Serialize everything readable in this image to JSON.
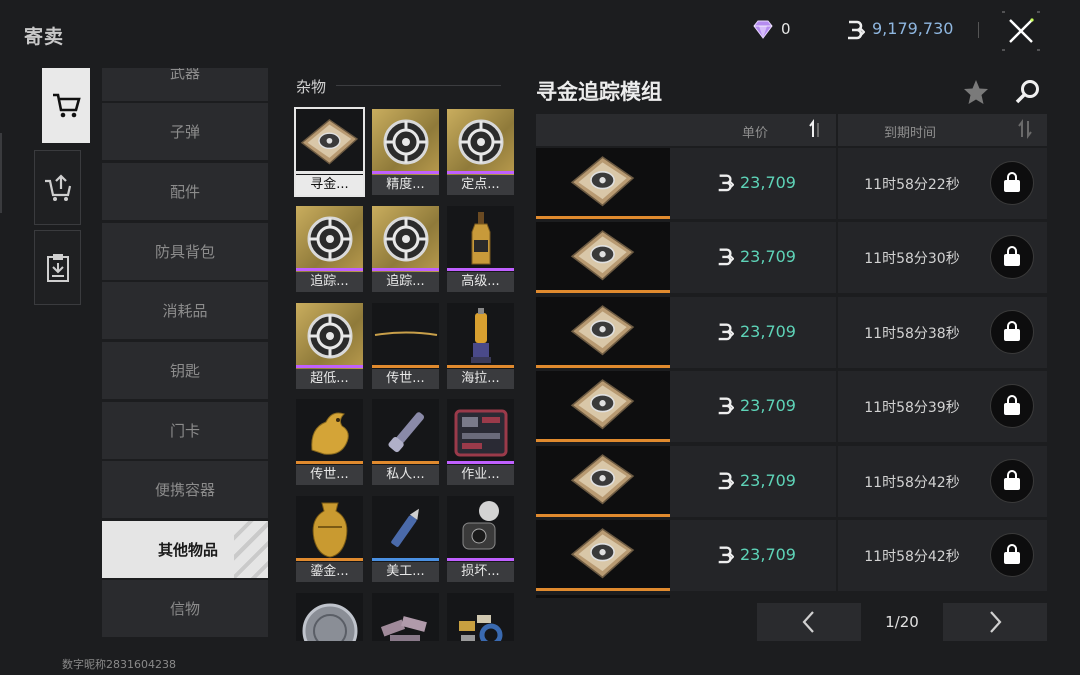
{
  "header": {
    "title": "寄卖",
    "gems": "0",
    "money": "9,179,730"
  },
  "categories": [
    {
      "label": "武器",
      "active": false
    },
    {
      "label": "子弹",
      "active": false
    },
    {
      "label": "配件",
      "active": false
    },
    {
      "label": "防具背包",
      "active": false
    },
    {
      "label": "消耗品",
      "active": false
    },
    {
      "label": "钥匙",
      "active": false
    },
    {
      "label": "门卡",
      "active": false
    },
    {
      "label": "便携容器",
      "active": false
    },
    {
      "label": "其他物品",
      "active": true
    },
    {
      "label": "信物",
      "active": false
    }
  ],
  "grid": {
    "title": "杂物",
    "items": [
      {
        "label": "寻金...",
        "icon": "gold-tracker-module-icon",
        "rarity": "#e6e6e6",
        "selected": true
      },
      {
        "label": "精度...",
        "icon": "precision-module-icon",
        "rarity": "#c060ff"
      },
      {
        "label": "定点...",
        "icon": "fixed-point-module-icon",
        "rarity": "#c060ff"
      },
      {
        "label": "追踪...",
        "icon": "tracking-module-a-icon",
        "rarity": "#c060ff"
      },
      {
        "label": "追踪...",
        "icon": "tracking-module-b-icon",
        "rarity": "#c060ff"
      },
      {
        "label": "高级...",
        "icon": "liquor-bottle-icon",
        "rarity": "#c060ff"
      },
      {
        "label": "超低...",
        "icon": "low-temp-module-icon",
        "rarity": "#c060ff"
      },
      {
        "label": "传世...",
        "icon": "heirloom-rod-icon",
        "rarity": "#e08a2e"
      },
      {
        "label": "海拉...",
        "icon": "hela-lamp-icon",
        "rarity": "#e08a2e"
      },
      {
        "label": "传世...",
        "icon": "golden-dragon-icon",
        "rarity": "#e08a2e"
      },
      {
        "label": "私人...",
        "icon": "flashlight-icon",
        "rarity": "#e08a2e"
      },
      {
        "label": "作业...",
        "icon": "toolkit-icon",
        "rarity": "#c060ff"
      },
      {
        "label": "鎏金...",
        "icon": "gilded-vase-icon",
        "rarity": "#e08a2e"
      },
      {
        "label": "美工...",
        "icon": "utility-knife-icon",
        "rarity": "#4a90e2"
      },
      {
        "label": "损坏...",
        "icon": "broken-device-icon",
        "rarity": "#c060ff"
      },
      {
        "label": "",
        "icon": "silver-coin-icon",
        "rarity": "#000000"
      },
      {
        "label": "",
        "icon": "metal-bars-icon",
        "rarity": "#000000"
      },
      {
        "label": "",
        "icon": "parts-pile-icon",
        "rarity": "#000000"
      }
    ]
  },
  "listing": {
    "title": "寻金追踪模组",
    "col_price": "单价",
    "col_expire": "到期时间",
    "rows": [
      {
        "price": "23,709",
        "time": "11时58分22秒"
      },
      {
        "price": "23,709",
        "time": "11时58分30秒"
      },
      {
        "price": "23,709",
        "time": "11时58分38秒"
      },
      {
        "price": "23,709",
        "time": "11时58分39秒"
      },
      {
        "price": "23,709",
        "time": "11时58分42秒"
      },
      {
        "price": "23,709",
        "time": "11时58分42秒"
      }
    ]
  },
  "pagination": {
    "page": "1/20"
  },
  "footer": {
    "user_id": "数字昵称2831604238"
  },
  "colors": {
    "price": "#5ed4b8",
    "money": "#8fb7e0",
    "rarity_orange": "#e08a2e",
    "rarity_purple": "#c060ff"
  }
}
